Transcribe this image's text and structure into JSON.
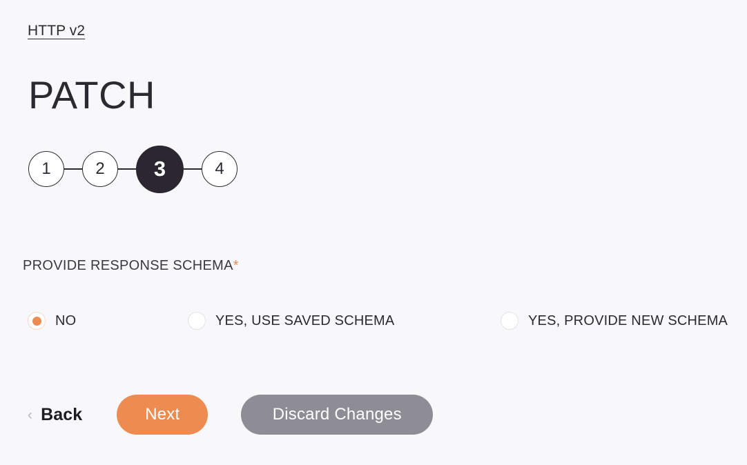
{
  "breadcrumb": {
    "label": "HTTP v2"
  },
  "header": {
    "title": "PATCH"
  },
  "stepper": {
    "current": 3,
    "steps": [
      {
        "label": "1",
        "active": false
      },
      {
        "label": "2",
        "active": false
      },
      {
        "label": "3",
        "active": true
      },
      {
        "label": "4",
        "active": false
      }
    ]
  },
  "form": {
    "field_label": "PROVIDE RESPONSE SCHEMA",
    "required_mark": "*",
    "options": [
      {
        "label": "NO",
        "selected": true
      },
      {
        "label": "YES, USE SAVED SCHEMA",
        "selected": false
      },
      {
        "label": "YES, PROVIDE NEW SCHEMA",
        "selected": false
      }
    ]
  },
  "actions": {
    "back_label": "Back",
    "back_icon": "‹",
    "next_label": "Next",
    "discard_label": "Discard Changes"
  },
  "colors": {
    "background": "#f8f8fa",
    "accent_orange": "#ed8b50",
    "required_orange": "#ee8b52",
    "dark": "#2b2730",
    "gray_button": "#8e8c95",
    "radio_border": "#e2e2e6"
  }
}
